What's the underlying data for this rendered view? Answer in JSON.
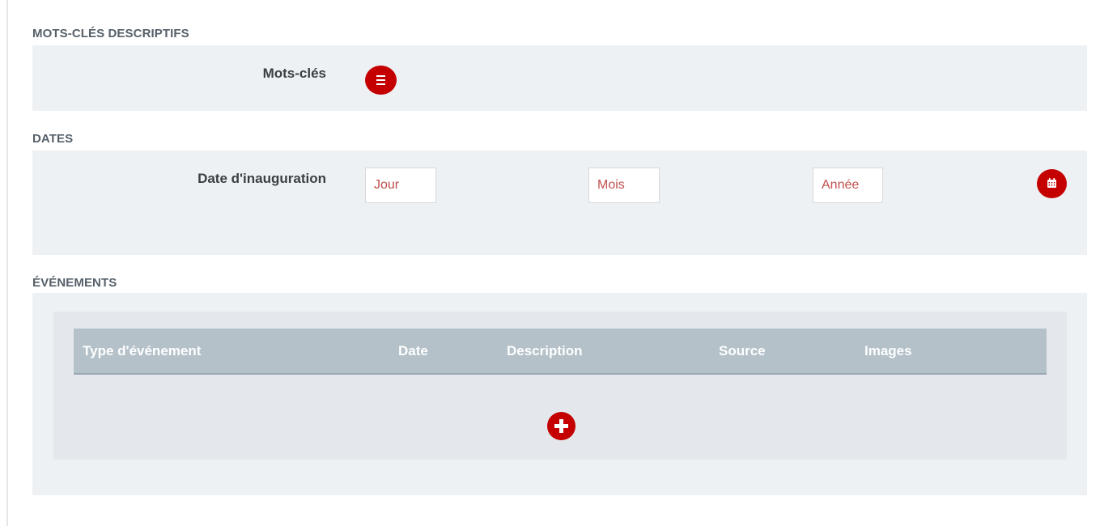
{
  "sections": {
    "keywords": {
      "title": "MOTS-CLÉS DESCRIPTIFS",
      "field_label": "Mots-clés",
      "list_icon": "list-icon"
    },
    "dates": {
      "title": "DATES",
      "field_label": "Date d'inauguration",
      "day_placeholder": "Jour",
      "month_placeholder": "Mois",
      "year_placeholder": "Année",
      "calendar_icon": "calendar-icon"
    },
    "events": {
      "title": "ÉVÉNEMENTS",
      "columns": [
        "Type d'événement",
        "Date",
        "Description",
        "Source",
        "Images"
      ],
      "add_icon": "plus-icon"
    }
  },
  "colors": {
    "accent_red": "#c40000",
    "panel_bg": "#eef1f4",
    "table_header_bg": "#b4c1c9",
    "placeholder_red": "#c0504d"
  }
}
